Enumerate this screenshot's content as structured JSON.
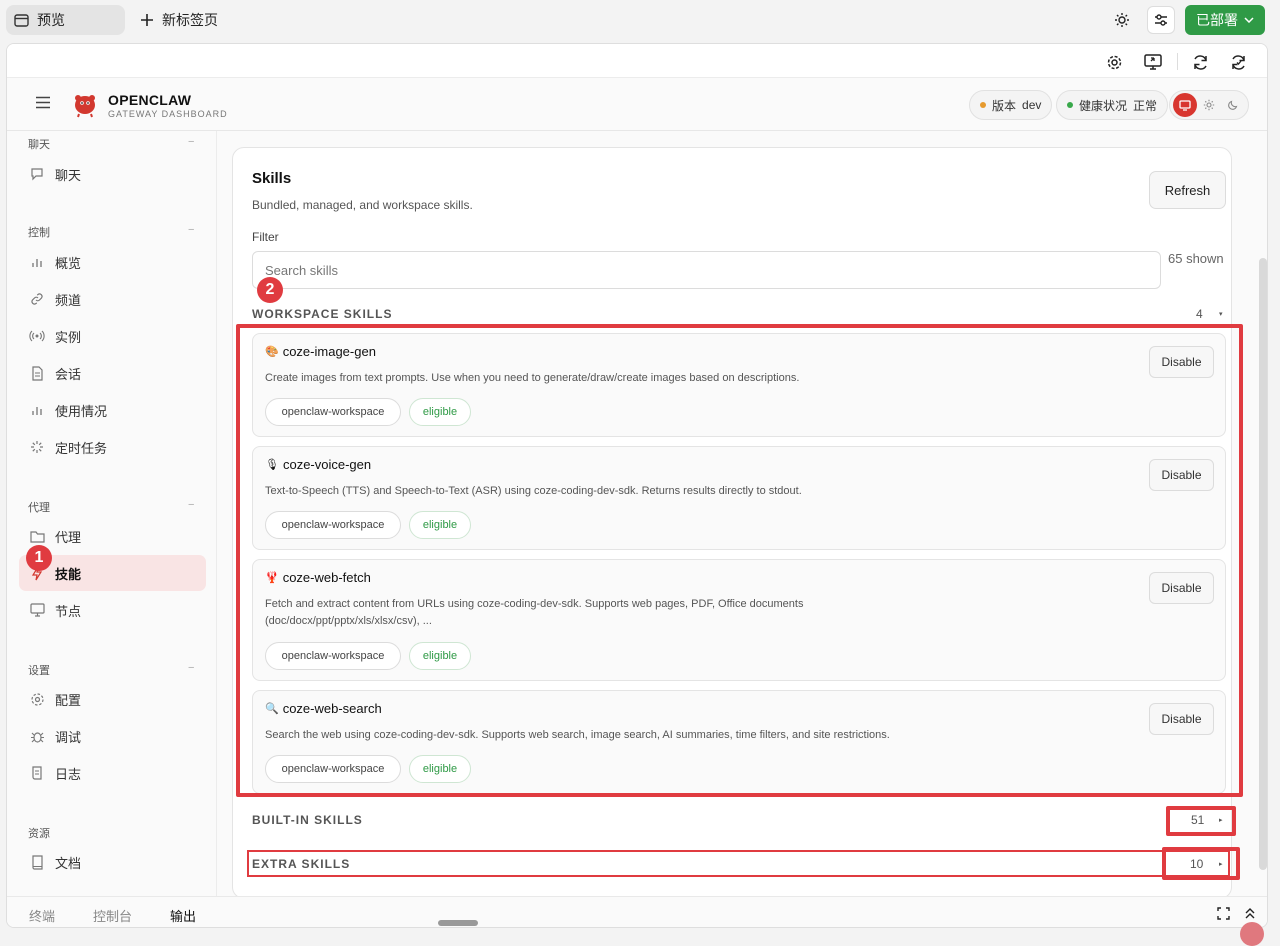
{
  "browser": {
    "tab_preview": "预览",
    "tab_new": "新标签页",
    "deploy_label": "已部署",
    "deploy_color": "#2f9a46"
  },
  "app": {
    "brand_title": "OPENCLAW",
    "brand_subtitle": "GATEWAY DASHBOARD",
    "version_label": "版本",
    "version_value": "dev",
    "health_label": "健康状况",
    "health_value": "正常",
    "accent_color": "#d8362f"
  },
  "sidebar": {
    "sections": [
      {
        "title": "聊天",
        "items": [
          {
            "label": "聊天",
            "icon": "chat-icon"
          }
        ]
      },
      {
        "title": "控制",
        "items": [
          {
            "label": "概览",
            "icon": "bar-chart-icon"
          },
          {
            "label": "频道",
            "icon": "link-icon"
          },
          {
            "label": "实例",
            "icon": "broadcast-icon"
          },
          {
            "label": "会话",
            "icon": "document-icon"
          },
          {
            "label": "使用情况",
            "icon": "bar-chart-icon"
          },
          {
            "label": "定时任务",
            "icon": "loader-icon"
          }
        ]
      },
      {
        "title": "代理",
        "items": [
          {
            "label": "代理",
            "icon": "folder-icon"
          },
          {
            "label": "技能",
            "icon": "lightning-icon",
            "active": true
          },
          {
            "label": "节点",
            "icon": "monitor-icon"
          }
        ]
      },
      {
        "title": "设置",
        "items": [
          {
            "label": "配置",
            "icon": "gear-icon"
          },
          {
            "label": "调试",
            "icon": "bug-icon"
          },
          {
            "label": "日志",
            "icon": "scroll-icon"
          }
        ]
      },
      {
        "title": "资源",
        "items": [
          {
            "label": "文档",
            "icon": "book-icon"
          }
        ]
      }
    ]
  },
  "skills_page": {
    "title": "Skills",
    "subtitle": "Bundled, managed, and workspace skills.",
    "refresh_label": "Refresh",
    "filter_label": "Filter",
    "search_placeholder": "Search skills",
    "shown_count": "65 shown",
    "workspace_group": {
      "title": "WORKSPACE SKILLS",
      "count": "4"
    },
    "builtin_group": {
      "title": "BUILT-IN SKILLS",
      "count": "51"
    },
    "extra_group": {
      "title": "EXTRA SKILLS",
      "count": "10"
    },
    "disable_label": "Disable",
    "skills": [
      {
        "emoji": "🎨",
        "name": "coze-image-gen",
        "desc": "Create images from text prompts. Use when you need to generate/draw/create images based on descriptions.",
        "source": "openclaw-workspace",
        "status": "eligible"
      },
      {
        "emoji": "🎙",
        "name": "coze-voice-gen",
        "desc": "Text-to-Speech (TTS) and Speech-to-Text (ASR) using coze-coding-dev-sdk. Returns results directly to stdout.",
        "source": "openclaw-workspace",
        "status": "eligible"
      },
      {
        "emoji": "🦞",
        "name": "coze-web-fetch",
        "desc": "Fetch and extract content from URLs using coze-coding-dev-sdk. Supports web pages, PDF, Office documents (doc/docx/ppt/pptx/xls/xlsx/csv), ...",
        "source": "openclaw-workspace",
        "status": "eligible"
      },
      {
        "emoji": "🔍",
        "name": "coze-web-search",
        "desc": "Search the web using coze-coding-dev-sdk. Supports web search, image search, AI summaries, time filters, and site restrictions.",
        "source": "openclaw-workspace",
        "status": "eligible"
      }
    ]
  },
  "bottom_tabs": [
    "终端",
    "控制台",
    "输出"
  ],
  "annotations": {
    "badge_1": "1",
    "badge_2": "2",
    "color": "#e03b40"
  }
}
